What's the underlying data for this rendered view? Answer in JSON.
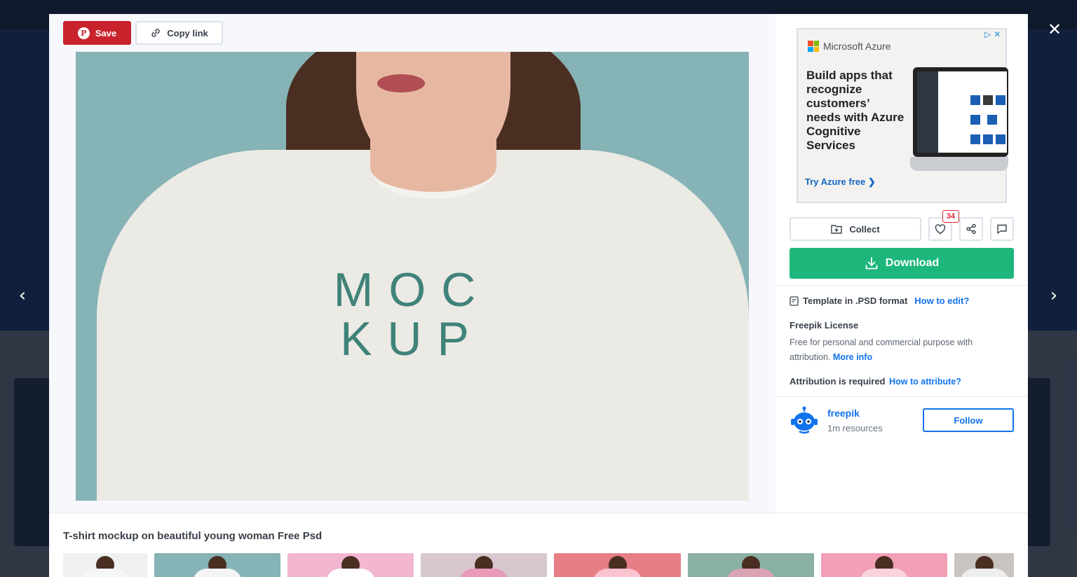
{
  "toolbar": {
    "save_label": "Save",
    "copy_link_label": "Copy link"
  },
  "preview": {
    "mockup_line1": "MOC",
    "mockup_line2": "KUP"
  },
  "ad": {
    "brand": "Microsoft Azure",
    "headline": "Build apps that recognize customers’ needs with Azure Cognitive Services",
    "cta": "Try Azure free ❯"
  },
  "actions": {
    "collect_label": "Collect",
    "like_count": "34",
    "download_label": "Download"
  },
  "file_info": {
    "format_text": "Template in .PSD format",
    "how_to_edit": "How to edit?"
  },
  "license": {
    "title": "Freepik License",
    "description": "Free for personal and commercial purpose with attribution.",
    "more_info": "More info",
    "attribution_text": "Attribution is required",
    "how_to_attribute": "How to attribute?"
  },
  "author": {
    "name": "freepik",
    "resources": "1m resources",
    "follow_label": "Follow"
  },
  "resource": {
    "title": "T-shirt mockup on beautiful young woman Free Psd"
  },
  "colors": {
    "save_red": "#c8232c",
    "download_green": "#1db77b",
    "link_blue": "#1273eb",
    "like_badge_red": "#e2252f"
  },
  "icons": [
    "pinterest-icon",
    "link-icon",
    "folder-plus-icon",
    "heart-icon",
    "share-icon",
    "comment-icon",
    "download-icon",
    "file-icon",
    "close-icon",
    "chevron-left-icon",
    "chevron-right-icon"
  ],
  "related_thumbnails": [
    {
      "bg": "#eef0f2",
      "shirt": "#f6f6f6"
    },
    {
      "bg": "#86b3b5",
      "shirt": "#f4f4f4"
    },
    {
      "bg": "#f2b6d1",
      "shirt": "#ffffff"
    },
    {
      "bg": "#d9c7cf",
      "shirt": "#e89ab8"
    },
    {
      "bg": "#e77e86",
      "shirt": "#f9c3cf"
    },
    {
      "bg": "#8bb0a6",
      "shirt": "#d9a3b4"
    },
    {
      "bg": "#f39fb6",
      "shirt": "#fbd3df"
    },
    {
      "bg": "#c9c4bf",
      "shirt": "#eeeeee"
    }
  ]
}
